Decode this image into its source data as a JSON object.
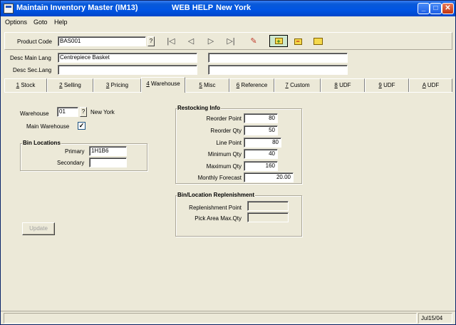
{
  "window": {
    "title": "Maintain Inventory Master (IM13)",
    "help_label": "WEB HELP",
    "location": "New York",
    "minimize": "_",
    "maximize": "□",
    "close": "✕"
  },
  "menu": {
    "items": [
      {
        "label": "Options"
      },
      {
        "label": "Goto"
      },
      {
        "label": "Help"
      }
    ]
  },
  "header": {
    "product_code_label": "Product Code",
    "product_code_value": "BAS001",
    "lookup": "?",
    "icons": {
      "first": "first-record-icon",
      "prev": "previous-record-icon",
      "next": "next-record-icon",
      "last": "last-record-icon",
      "edit": "edit-icon",
      "add": "add-record-icon",
      "delete": "delete-record-icon",
      "folder": "folder-icon"
    },
    "glyphs": {
      "first": "|◁",
      "prev": "◁",
      "next": "▷",
      "last": "▷|",
      "edit": "✎",
      "add": "+",
      "delete": "−",
      "folder": ""
    }
  },
  "descriptions": {
    "main_label": "Desc Main Lang",
    "main_value": "Centrepiece Basket",
    "main_value2": "",
    "sec_label": "Desc Sec.Lang",
    "sec_value": "",
    "sec_value2": ""
  },
  "tabs": [
    {
      "key": "1",
      "label": "Stock"
    },
    {
      "key": "2",
      "label": "Selling"
    },
    {
      "key": "3",
      "label": "Pricing"
    },
    {
      "key": "4",
      "label": "Warehouse"
    },
    {
      "key": "5",
      "label": "Misc"
    },
    {
      "key": "6",
      "label": "Reference"
    },
    {
      "key": "7",
      "label": "Custom"
    },
    {
      "key": "8",
      "label": "UDF"
    },
    {
      "key": "9",
      "label": "UDF"
    },
    {
      "key": "A",
      "label": "UDF"
    }
  ],
  "warehouse": {
    "label": "Warehouse",
    "value": "01",
    "lookup": "?",
    "name": "New York",
    "main_label": "Main Warehouse",
    "main_checked": "✓"
  },
  "bin_locations": {
    "title": "Bin Locations",
    "primary_label": "Primary",
    "primary_value": "1H1B6",
    "secondary_label": "Secondary",
    "secondary_value": ""
  },
  "update_button": "Update",
  "restocking": {
    "title": "Restocking Info",
    "fields": [
      {
        "label": "Reorder Point",
        "value": "80"
      },
      {
        "label": "Reorder Qty",
        "value": "50"
      },
      {
        "label": "Line Point",
        "value": "80"
      },
      {
        "label": "Minimum Qty",
        "value": "40"
      },
      {
        "label": "Maximum Qty",
        "value": "160"
      },
      {
        "label": "Monthly Forecast",
        "value": "20.00"
      }
    ]
  },
  "replenishment": {
    "title": "Bin/Location Replenishment",
    "point_label": "Replenishment Point",
    "point_value": "",
    "max_label": "Pick Area Max.Qty",
    "max_value": ""
  },
  "status": {
    "message": "",
    "date": "Jul15/04"
  },
  "colors": {
    "titlebar": "#0054e3",
    "background": "#ece9d8"
  }
}
